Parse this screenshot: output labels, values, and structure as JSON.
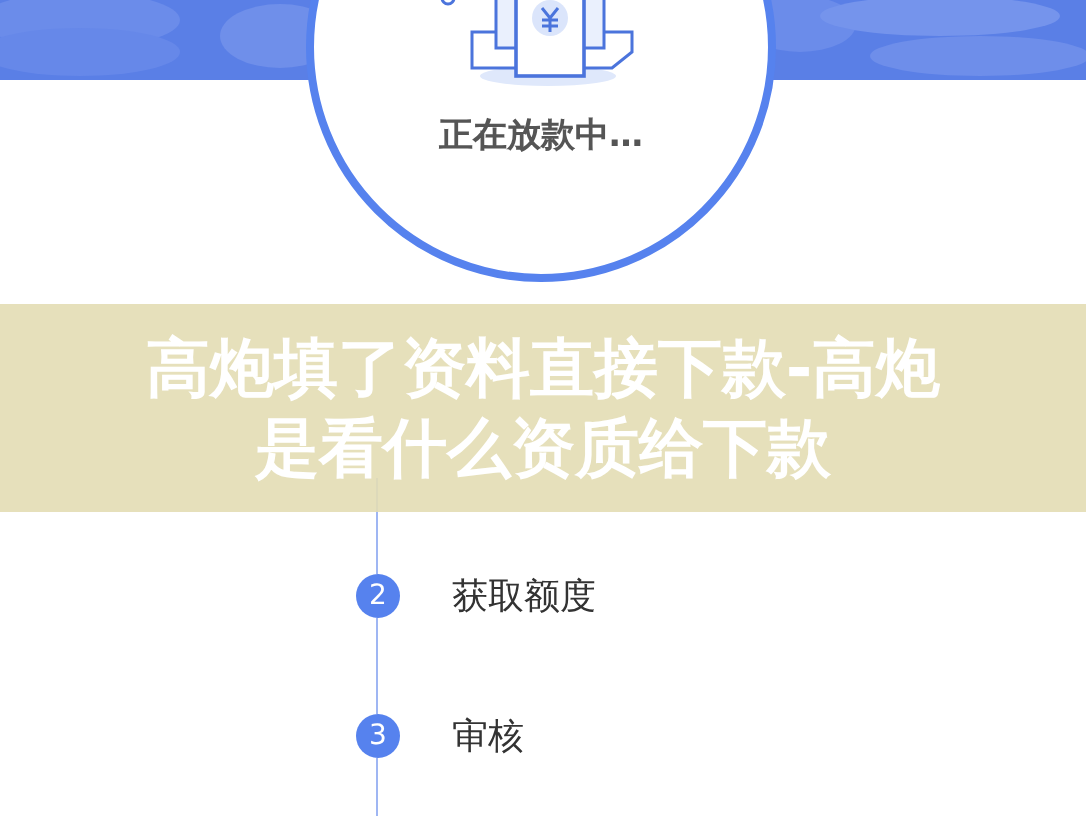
{
  "status_card": {
    "text": "正在放款中…"
  },
  "steps": [
    {
      "number": "2",
      "label": "获取额度"
    },
    {
      "number": "3",
      "label": "审核"
    }
  ],
  "banner": {
    "title": "高炮填了资料直接下款-高炮是看什么资质给下款"
  }
}
